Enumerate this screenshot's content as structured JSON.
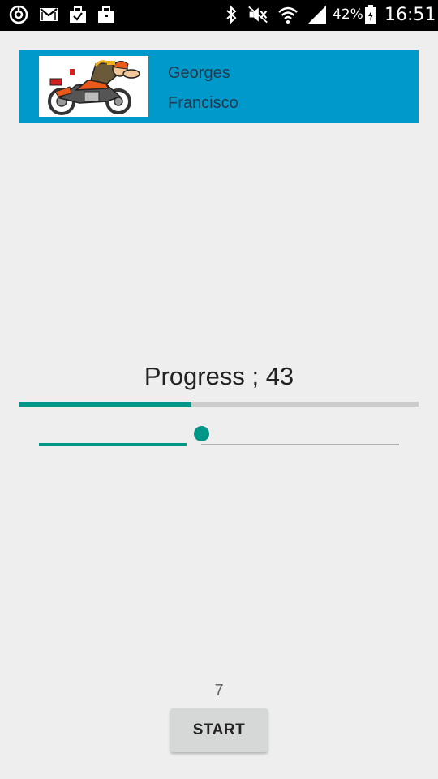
{
  "status_bar": {
    "battery_percent": "42%",
    "time": "16:51",
    "left_icons": [
      "sync-icon",
      "gmail-icon",
      "briefcase-check-icon",
      "briefcase-icon"
    ],
    "right_icons": [
      "bluetooth-icon",
      "vibrate-mute-icon",
      "wifi-icon",
      "signal-icon",
      "battery-icon"
    ]
  },
  "header": {
    "background_color": "#0099cc",
    "image_icon": "motorcycle-rider-cartoon",
    "first_name": "Georges",
    "last_name": "Francisco"
  },
  "progress": {
    "label": "Progress ; 43",
    "value_percent": 43,
    "accent_color": "#009688"
  },
  "slider": {
    "value_percent": 43
  },
  "counter": {
    "value": "7"
  },
  "actions": {
    "start_label": "START"
  }
}
